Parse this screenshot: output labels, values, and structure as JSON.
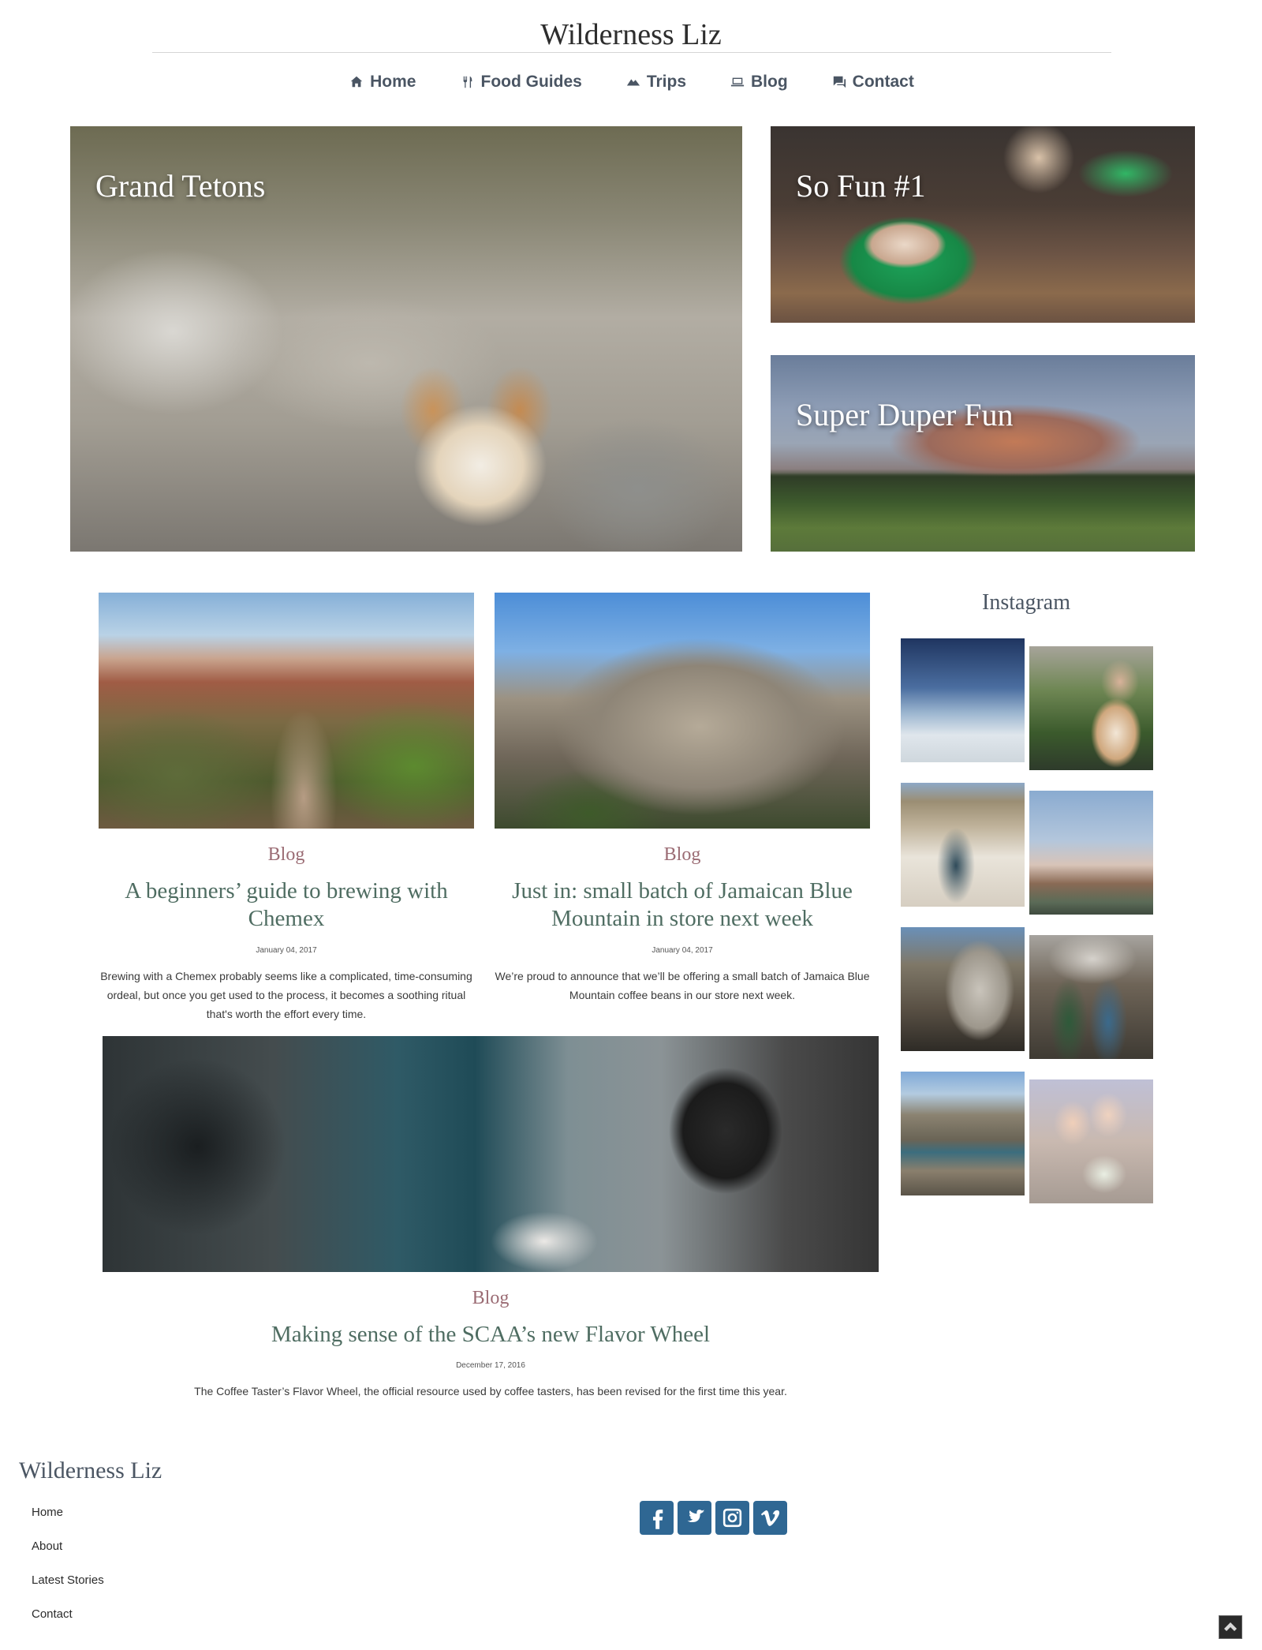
{
  "site": {
    "title": "Wilderness Liz"
  },
  "nav": {
    "items": [
      {
        "label": "Home",
        "icon": "home-icon"
      },
      {
        "label": "Food Guides",
        "icon": "utensils-icon"
      },
      {
        "label": "Trips",
        "icon": "mountain-icon"
      },
      {
        "label": "Blog",
        "icon": "laptop-icon"
      },
      {
        "label": "Contact",
        "icon": "chat-icon"
      }
    ]
  },
  "hero": {
    "tiles": [
      {
        "title": "Grand Tetons"
      },
      {
        "title": "So Fun #1"
      },
      {
        "title": "Super Duper Fun"
      }
    ]
  },
  "posts": [
    {
      "category": "Blog",
      "title": "A beginners’ guide to brewing with Chemex",
      "date": "January 04, 2017",
      "excerpt": "Brewing with a Chemex probably seems like a complicated, time-consuming ordeal, but once you get used to the process, it becomes a soothing ritual that's worth the effort every time."
    },
    {
      "category": "Blog",
      "title": "Just in: small batch of Jamaican Blue Mountain in store next week",
      "date": "January 04, 2017",
      "excerpt": "We’re proud to announce that we’ll be offering a small batch of Jamaica Blue Mountain coffee beans in our store next week."
    },
    {
      "category": "Blog",
      "title": "Making sense of the SCAA’s new Flavor Wheel",
      "date": "December 17, 2016",
      "excerpt": "The Coffee Taster’s Flavor Wheel, the official resource used by coffee tasters, has been revised for the first time this year."
    }
  ],
  "instagram": {
    "title": "Instagram",
    "count_shown": 8
  },
  "footer": {
    "title": "Wilderness Liz",
    "links": [
      "Home",
      "About",
      "Latest Stories",
      "Contact"
    ],
    "social": [
      "facebook-icon",
      "twitter-icon",
      "instagram-icon",
      "vimeo-icon"
    ]
  },
  "colors": {
    "accent_blue": "#2f6793",
    "title_green": "#4f6d62",
    "category_mauve": "#9b6c74",
    "nav_slate": "#4a5563"
  }
}
